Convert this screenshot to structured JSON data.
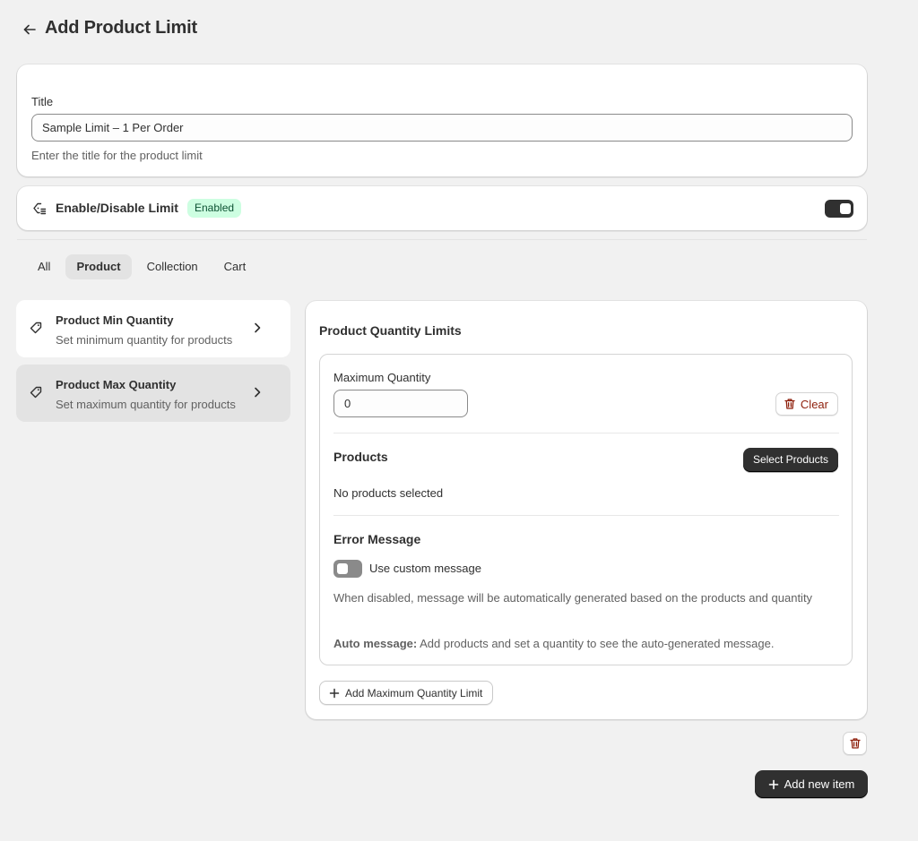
{
  "header": {
    "title": "Add Product Limit",
    "back_icon": "arrow-left-icon"
  },
  "title_card": {
    "label": "Title",
    "value": "Sample Limit – 1 Per Order",
    "help": "Enter the title for the product limit"
  },
  "enable_card": {
    "icon": "discount-icon",
    "label": "Enable/Disable Limit",
    "badge": "Enabled",
    "toggle_on": true
  },
  "tabs": [
    {
      "label": "All",
      "active": false
    },
    {
      "label": "Product",
      "active": true
    },
    {
      "label": "Collection",
      "active": false
    },
    {
      "label": "Cart",
      "active": false
    }
  ],
  "side_items": [
    {
      "title": "Product Min Quantity",
      "desc": "Set minimum quantity for products",
      "selected": false
    },
    {
      "title": "Product Max Quantity",
      "desc": "Set maximum quantity for products",
      "selected": true
    }
  ],
  "panel": {
    "title": "Product Quantity Limits",
    "max_label": "Maximum Quantity",
    "max_value": "0",
    "clear_label": "Clear",
    "products_title": "Products",
    "select_products_label": "Select Products",
    "no_products": "No products selected",
    "error_title": "Error Message",
    "custom_toggle_label": "Use custom message",
    "custom_toggle_on": false,
    "disabled_desc": "When disabled, message will be automatically generated based on the products and quantity",
    "auto_label": "Auto message:",
    "auto_text": "Add products and set a quantity to see the auto-generated message.",
    "add_max_label": "Add Maximum Quantity Limit"
  },
  "footer": {
    "add_new_label": "Add new item"
  },
  "colors": {
    "primary": "#303030",
    "badge_bg": "#cdfee1",
    "badge_text": "#0c5132",
    "critical": "#8e1f0b",
    "page_bg": "#f1f1f1"
  }
}
